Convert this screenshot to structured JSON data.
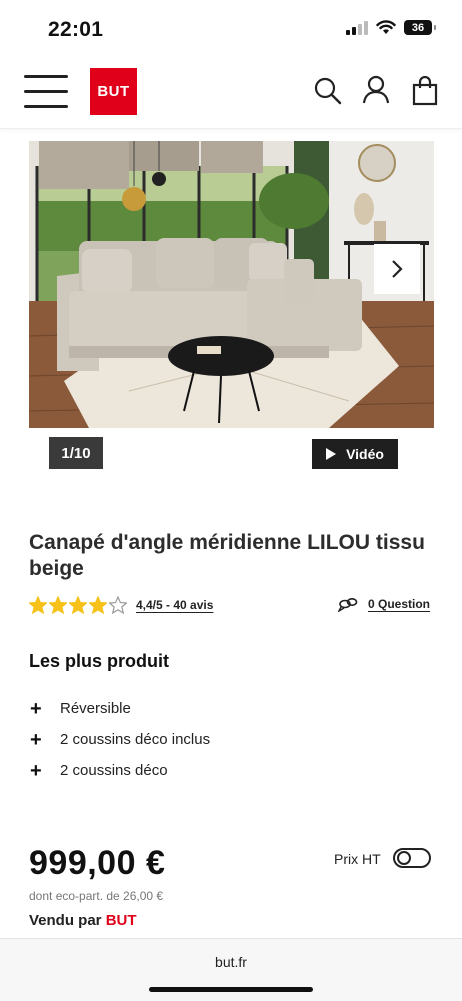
{
  "status_bar": {
    "time": "22:01",
    "battery": "36"
  },
  "header": {
    "logo_text": "BUT"
  },
  "gallery": {
    "counter": "1/10",
    "video_label": "Vidéo"
  },
  "product": {
    "title": "Canapé d'angle méridienne LILOU tissu beige",
    "rating": {
      "stars": 4.4,
      "max": 5,
      "text": "4,4/5 - 40 avis"
    },
    "question_label": "0 Question"
  },
  "features": {
    "title": "Les plus produit",
    "items": [
      {
        "label": "Réversible"
      },
      {
        "label": "2 coussins déco inclus"
      },
      {
        "label": "2 coussins déco"
      }
    ]
  },
  "pricing": {
    "price": "999,00 €",
    "eco_part": "dont eco-part. de 26,00 €",
    "sold_by_prefix": "Vendu par",
    "sold_by_brand": "BUT",
    "prix_ht_label": "Prix HT",
    "prix_ht_enabled": false
  },
  "browser": {
    "url": "but.fr"
  },
  "colors": {
    "brand": "#e0001a",
    "star": "#f6c21a",
    "dark": "#1f1f1f"
  }
}
